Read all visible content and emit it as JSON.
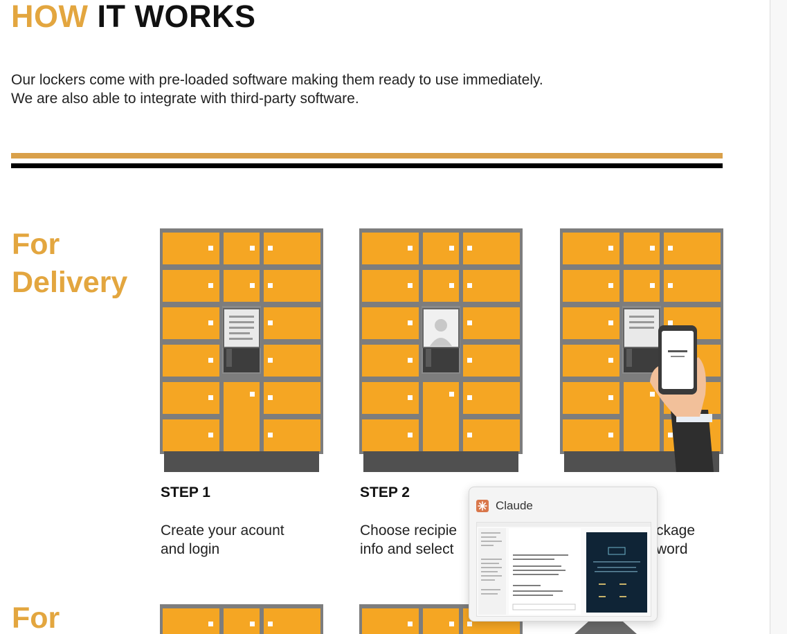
{
  "header": {
    "title_highlight": "HOW",
    "title_rest": "IT WORKS"
  },
  "intro": {
    "line1": "Our lockers come with pre-loaded software making them ready to use immediately.",
    "line2": "We are also able to integrate with third-party software."
  },
  "sections": [
    {
      "label_line1": "For",
      "label_line2": "Delivery",
      "steps": [
        {
          "title": "STEP 1",
          "desc_line1": "Create your acount",
          "desc_line2": "and login"
        },
        {
          "title": "STEP 2",
          "desc_line1": "Choose recipie",
          "desc_line2": "info and select"
        },
        {
          "title": "",
          "desc_line1": "ckage",
          "desc_line2": "word"
        }
      ]
    },
    {
      "label_line1": "For"
    }
  ],
  "popup": {
    "app_name": "Claude",
    "icon": "claude-logo-icon"
  },
  "colors": {
    "gold": "#e3a63f",
    "locker_orange": "#f5a623",
    "locker_frame": "#7d7d7d",
    "base": "#505050"
  }
}
